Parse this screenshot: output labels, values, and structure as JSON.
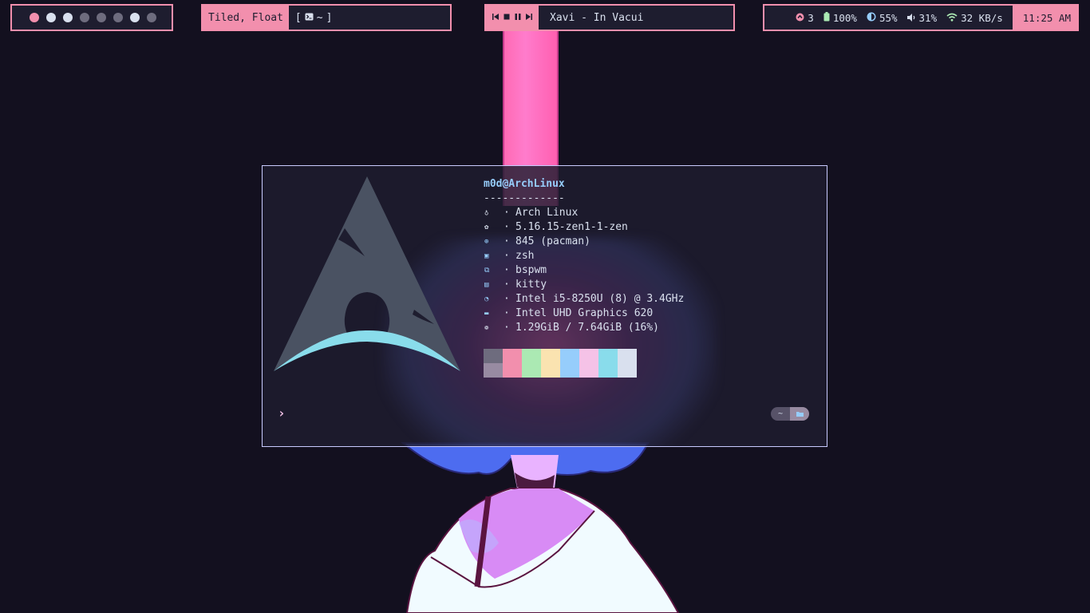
{
  "colors": {
    "accent": "#f28fad",
    "bar_bg": "#1e1d2f",
    "desktop_bg": "#13101f",
    "terminal_border": "#c9cbff",
    "host_color": "#96cdfb"
  },
  "workspaces": [
    {
      "state": "active"
    },
    {
      "state": "occupied"
    },
    {
      "state": "occupied"
    },
    {
      "state": "empty"
    },
    {
      "state": "empty"
    },
    {
      "state": "empty"
    },
    {
      "state": "occupied"
    },
    {
      "state": "empty"
    }
  ],
  "layout": {
    "mode": "Tiled, Float",
    "window_title_open": "[",
    "window_icon": "terminal-icon",
    "window_title": "~",
    "window_title_close": "]"
  },
  "player": {
    "prev_icon": "previous-icon",
    "stop_icon": "stop-icon",
    "pause_icon": "pause-icon",
    "next_icon": "next-icon",
    "song": "Xavi - In Vacui"
  },
  "status": {
    "updates": "3",
    "battery": "100%",
    "brightness": "55%",
    "volume": "31%",
    "network": "32 KB/s",
    "clock": "11:25 AM"
  },
  "terminal": {
    "host": "m0d@ArchLinux",
    "separator": "-------------",
    "info": [
      {
        "icon": "arch-icon",
        "value": "Arch Linux"
      },
      {
        "icon": "kernel-gear-icon",
        "value": "5.16.15-zen1-1-zen"
      },
      {
        "icon": "package-icon",
        "value": "845 (pacman)"
      },
      {
        "icon": "shell-icon",
        "value": "zsh"
      },
      {
        "icon": "window-manager-icon",
        "value": "bspwm"
      },
      {
        "icon": "terminal-app-icon",
        "value": "kitty"
      },
      {
        "icon": "cpu-icon",
        "value": "Intel i5-8250U (8) @ 3.4GHz"
      },
      {
        "icon": "gpu-icon",
        "value": "Intel UHD Graphics 620"
      },
      {
        "icon": "memory-icon",
        "value": "1.29GiB / 7.64GiB (16%)"
      }
    ],
    "info_dot": "·",
    "palette_top": [
      "#6e6c7e",
      "#f28fad",
      "#abe9b3",
      "#fae3b0",
      "#96cdfb",
      "#f5c2e7",
      "#89dceb",
      "#d9e0ee"
    ],
    "palette_bottom": [
      "#988ba2",
      "#f28fad",
      "#abe9b3",
      "#fae3b0",
      "#96cdfb",
      "#f5c2e7",
      "#89dceb",
      "#d9e0ee"
    ],
    "prompt_symbol": "›",
    "cwd": "~",
    "cwd_icon": "folder-icon"
  }
}
